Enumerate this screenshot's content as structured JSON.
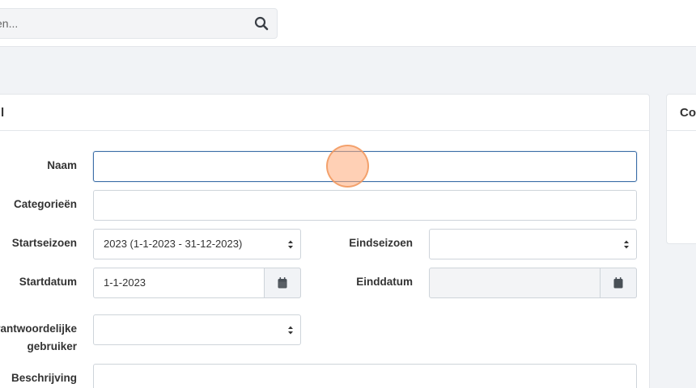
{
  "search": {
    "placeholder": "en..."
  },
  "main_card": {
    "title": "l"
  },
  "side_card": {
    "title": "Co"
  },
  "form": {
    "naam_label": "Naam",
    "naam_value": "",
    "categorieen_label": "Categorieën",
    "categorieen_value": "",
    "startseizoen_label": "Startseizoen",
    "startseizoen_value": "2023 (1-1-2023 - 31-12-2023)",
    "eindseizoen_label": "Eindseizoen",
    "eindseizoen_value": "",
    "startdatum_label": "Startdatum",
    "startdatum_value": "1-1-2023",
    "einddatum_label": "Einddatum",
    "einddatum_value": "",
    "verantwoordelijke_label_line1": "rantwoordelijke",
    "verantwoordelijke_label_line2": "gebruiker",
    "verantwoordelijke_value": "",
    "beschrijving_label": "Beschrijving"
  },
  "colors": {
    "focus": "#3d6fa8",
    "click_indicator": "#f5a570"
  }
}
